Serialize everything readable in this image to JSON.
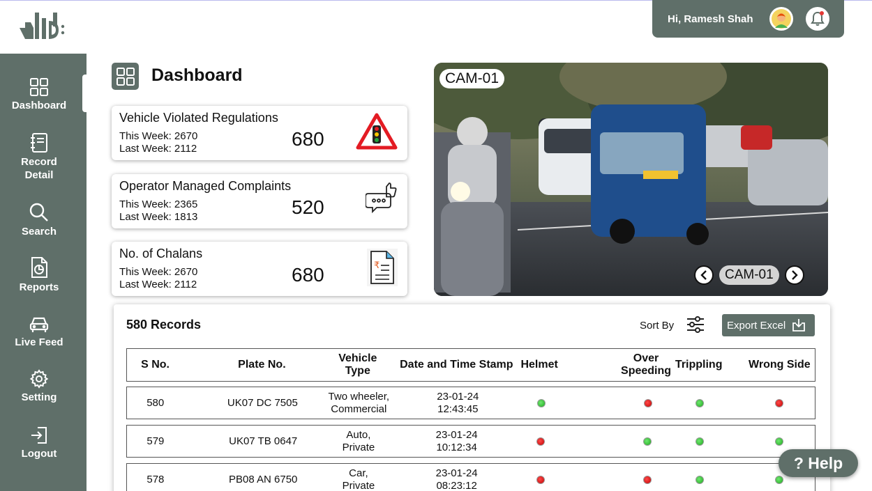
{
  "user": {
    "greeting": "Hi, Ramesh Shah"
  },
  "sidebar": {
    "items": [
      {
        "label": "Dashboard"
      },
      {
        "label": "Record Detail"
      },
      {
        "label": "Search"
      },
      {
        "label": "Reports"
      },
      {
        "label": "Live Feed"
      },
      {
        "label": "Setting"
      },
      {
        "label": "Logout"
      }
    ]
  },
  "page": {
    "title": "Dashboard"
  },
  "cards": [
    {
      "title": "Vehicle Violated Regulations",
      "this_week": "This Week: 2670",
      "last_week": "Last Week: 2112",
      "value": "680"
    },
    {
      "title": "Operator Managed Complaints",
      "this_week": "This Week: 2365",
      "last_week": "Last Week: 1813",
      "value": "520"
    },
    {
      "title": "No. of Chalans",
      "this_week": "This Week: 2670",
      "last_week": "Last Week: 2112",
      "value": "680"
    }
  ],
  "camera": {
    "tag": "CAM-01",
    "selector": "CAM-01"
  },
  "records": {
    "count_label": "580 Records",
    "sort_label": "Sort By",
    "export_label": "Export Excel",
    "headers": [
      "S No.",
      "Plate No.",
      "Vehicle Type",
      "Date and Time Stamp",
      "Helmet",
      "Over Speeding",
      "Trippling",
      "Wrong Side"
    ],
    "rows": [
      {
        "sno": "580",
        "plate": "UK07 DC 7505",
        "type": "Two wheeler, Commercial",
        "date": "23-01-24",
        "time": "12:43:45",
        "helmet": "ok",
        "speeding": "bad",
        "trippling": "ok",
        "wrong_side": "bad"
      },
      {
        "sno": "579",
        "plate": "UK07 TB 0647",
        "type": "Auto, Private",
        "date": "23-01-24",
        "time": "10:12:34",
        "helmet": "bad",
        "speeding": "ok",
        "trippling": "ok",
        "wrong_side": "ok"
      },
      {
        "sno": "578",
        "plate": "PB08 AN 6750",
        "type": "Car, Private",
        "date": "23-01-24",
        "time": "08:23:12",
        "helmet": "bad",
        "speeding": "bad",
        "trippling": "ok",
        "wrong_side": "ok"
      }
    ]
  },
  "help": {
    "label": "? Help"
  },
  "colors": {
    "brand": "#5f6f69",
    "ok": "#1fa81f",
    "bad": "#c20000"
  }
}
